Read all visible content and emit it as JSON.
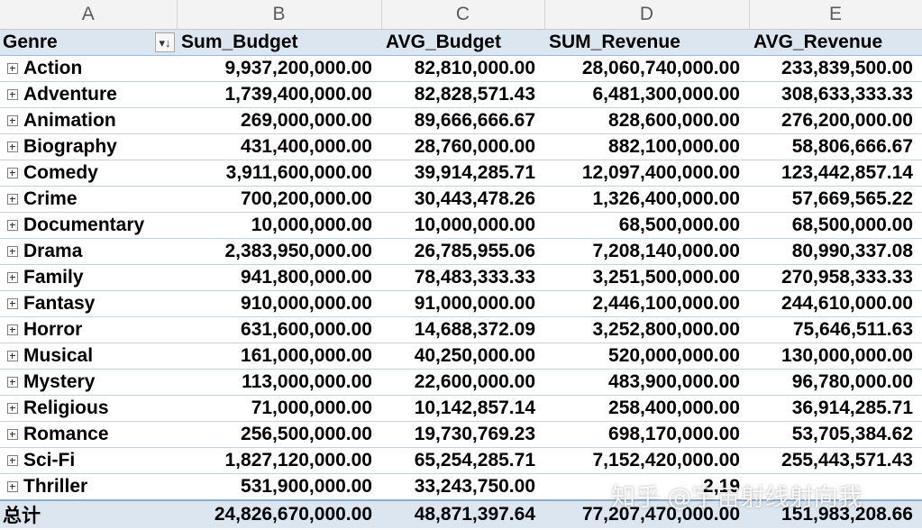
{
  "column_letters": [
    "A",
    "B",
    "C",
    "D",
    "E"
  ],
  "pivot_header": {
    "genre": "Genre",
    "sum_budget": "Sum_Budget",
    "avg_budget": "AVG_Budget",
    "sum_revenue": "SUM_Revenue",
    "avg_revenue": "AVG_Revenue",
    "filter_icon": "sort-filter-dropdown-icon"
  },
  "rows": [
    {
      "genre": "Action",
      "sum_budget": "9,937,200,000.00",
      "avg_budget": "82,810,000.00",
      "sum_revenue": "28,060,740,000.00",
      "avg_revenue": "233,839,500.00"
    },
    {
      "genre": "Adventure",
      "sum_budget": "1,739,400,000.00",
      "avg_budget": "82,828,571.43",
      "sum_revenue": "6,481,300,000.00",
      "avg_revenue": "308,633,333.33"
    },
    {
      "genre": "Animation",
      "sum_budget": "269,000,000.00",
      "avg_budget": "89,666,666.67",
      "sum_revenue": "828,600,000.00",
      "avg_revenue": "276,200,000.00"
    },
    {
      "genre": "Biography",
      "sum_budget": "431,400,000.00",
      "avg_budget": "28,760,000.00",
      "sum_revenue": "882,100,000.00",
      "avg_revenue": "58,806,666.67"
    },
    {
      "genre": "Comedy",
      "sum_budget": "3,911,600,000.00",
      "avg_budget": "39,914,285.71",
      "sum_revenue": "12,097,400,000.00",
      "avg_revenue": "123,442,857.14"
    },
    {
      "genre": "Crime",
      "sum_budget": "700,200,000.00",
      "avg_budget": "30,443,478.26",
      "sum_revenue": "1,326,400,000.00",
      "avg_revenue": "57,669,565.22"
    },
    {
      "genre": "Documentary",
      "sum_budget": "10,000,000.00",
      "avg_budget": "10,000,000.00",
      "sum_revenue": "68,500,000.00",
      "avg_revenue": "68,500,000.00"
    },
    {
      "genre": "Drama",
      "sum_budget": "2,383,950,000.00",
      "avg_budget": "26,785,955.06",
      "sum_revenue": "7,208,140,000.00",
      "avg_revenue": "80,990,337.08"
    },
    {
      "genre": "Family",
      "sum_budget": "941,800,000.00",
      "avg_budget": "78,483,333.33",
      "sum_revenue": "3,251,500,000.00",
      "avg_revenue": "270,958,333.33"
    },
    {
      "genre": "Fantasy",
      "sum_budget": "910,000,000.00",
      "avg_budget": "91,000,000.00",
      "sum_revenue": "2,446,100,000.00",
      "avg_revenue": "244,610,000.00"
    },
    {
      "genre": "Horror",
      "sum_budget": "631,600,000.00",
      "avg_budget": "14,688,372.09",
      "sum_revenue": "3,252,800,000.00",
      "avg_revenue": "75,646,511.63"
    },
    {
      "genre": "Musical",
      "sum_budget": "161,000,000.00",
      "avg_budget": "40,250,000.00",
      "sum_revenue": "520,000,000.00",
      "avg_revenue": "130,000,000.00"
    },
    {
      "genre": "Mystery",
      "sum_budget": "113,000,000.00",
      "avg_budget": "22,600,000.00",
      "sum_revenue": "483,900,000.00",
      "avg_revenue": "96,780,000.00"
    },
    {
      "genre": "Religious",
      "sum_budget": "71,000,000.00",
      "avg_budget": "10,142,857.14",
      "sum_revenue": "258,400,000.00",
      "avg_revenue": "36,914,285.71"
    },
    {
      "genre": "Romance",
      "sum_budget": "256,500,000.00",
      "avg_budget": "19,730,769.23",
      "sum_revenue": "698,170,000.00",
      "avg_revenue": "53,705,384.62"
    },
    {
      "genre": "Sci-Fi",
      "sum_budget": "1,827,120,000.00",
      "avg_budget": "65,254,285.71",
      "sum_revenue": "7,152,420,000.00",
      "avg_revenue": "255,443,571.43"
    },
    {
      "genre": "Thriller",
      "sum_budget": "531,900,000.00",
      "avg_budget": "33,243,750.00",
      "sum_revenue": "2,19",
      "avg_revenue": ""
    }
  ],
  "total": {
    "label": "总计",
    "sum_budget": "24,826,670,000.00",
    "avg_budget": "48,871,397.64",
    "sum_revenue": "77,207,470,000.00",
    "avg_revenue": "151,983,208.66"
  },
  "watermark": "知乎 @宇宙射线射向我",
  "colors": {
    "header_fill": "#dce6f1",
    "column_header_fill": "#f3f3f3",
    "row_border": "#c5d3e6"
  }
}
